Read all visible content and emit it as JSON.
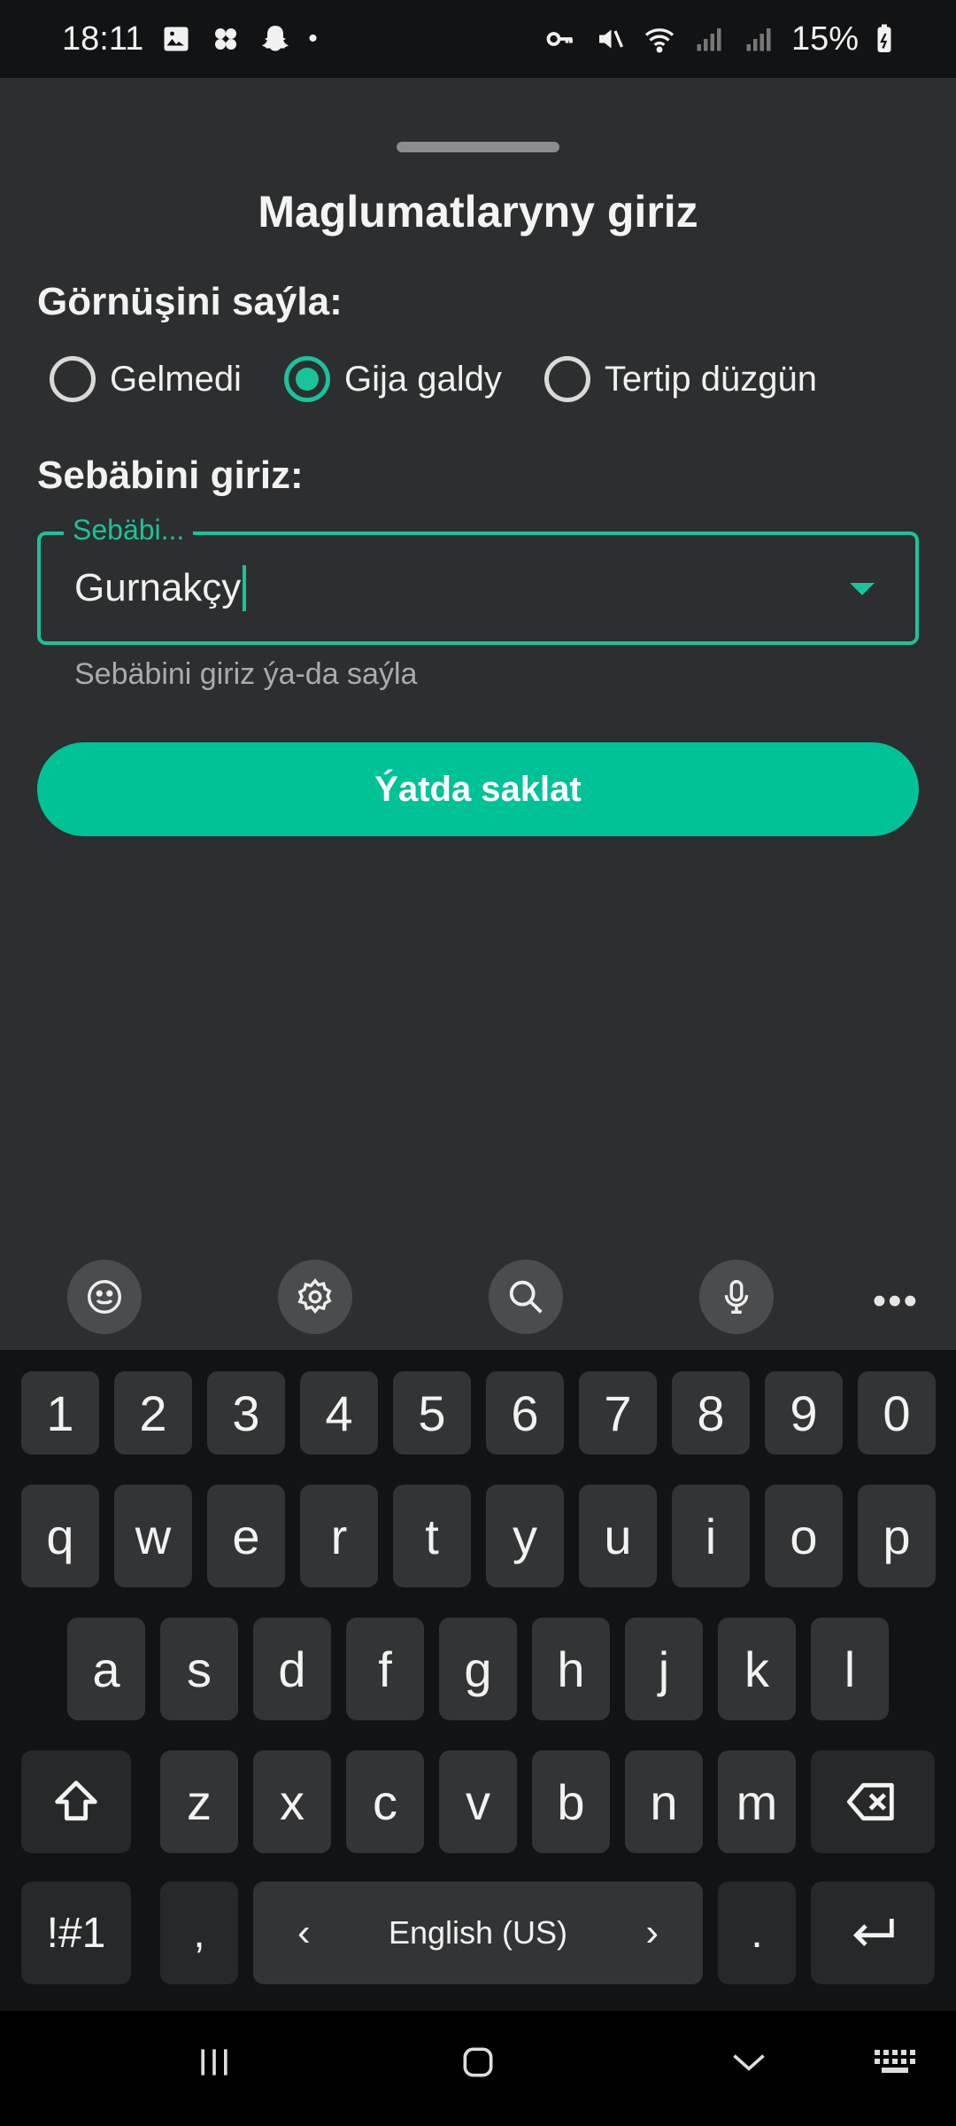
{
  "status_bar": {
    "time": "18:11",
    "dot": "•",
    "battery": "15%",
    "icons_left": [
      "image-icon",
      "pinwheel-icon",
      "snapchat-ghost-icon"
    ],
    "icons_right": [
      "key-icon",
      "mute-icon",
      "wifi-icon",
      "signal-icon",
      "signal-icon",
      "battery-icon"
    ]
  },
  "sheet": {
    "title": "Maglumatlaryny giriz",
    "type_label": "Görnüşini saýla:",
    "options": [
      {
        "label": "Gelmedi",
        "checked": false
      },
      {
        "label": "Gija galdy",
        "checked": true
      },
      {
        "label": "Tertip düzgün",
        "checked": false
      }
    ],
    "reason_label": "Sebäbini giriz:",
    "reason_field": {
      "floating_label": "Sebäbi...",
      "value": "Gurnakçy",
      "helper": "Sebäbini giriz ýa-da saýla"
    },
    "save_label": "Ýatda saklat",
    "accent": "#00c297"
  },
  "keyboard": {
    "toolbar": [
      "emoji-icon",
      "settings-icon",
      "search-icon",
      "microphone-icon"
    ],
    "more": "•••",
    "row_numbers": [
      "1",
      "2",
      "3",
      "4",
      "5",
      "6",
      "7",
      "8",
      "9",
      "0"
    ],
    "row_q": [
      "q",
      "w",
      "e",
      "r",
      "t",
      "y",
      "u",
      "i",
      "o",
      "p"
    ],
    "row_a": [
      "a",
      "s",
      "d",
      "f",
      "g",
      "h",
      "j",
      "k",
      "l"
    ],
    "row_z": [
      "z",
      "x",
      "c",
      "v",
      "b",
      "n",
      "m"
    ],
    "symbols": "!#1",
    "comma": ",",
    "language": "English (US)",
    "prev": "‹",
    "next": "›",
    "period": "."
  }
}
